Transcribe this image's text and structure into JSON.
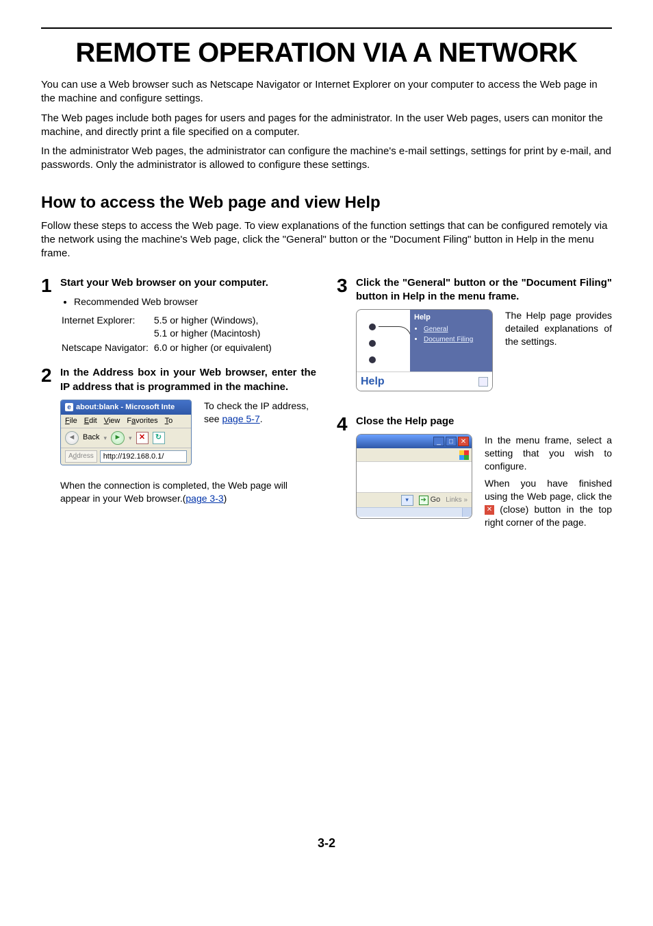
{
  "title": "REMOTE OPERATION VIA A NETWORK",
  "intro": {
    "p1": "You can use a Web browser such as Netscape Navigator or Internet Explorer on your computer to access the Web page in the machine and configure settings.",
    "p2": "The Web pages include both pages for users and pages for the administrator. In the user Web pages, users can monitor the machine, and directly print a file specified on a computer.",
    "p3": "In the administrator Web pages, the administrator can configure the machine's e-mail settings, settings for print by e-mail, and passwords. Only the administrator is allowed to configure these settings."
  },
  "section": {
    "heading": "How to access the Web page and view Help",
    "intro": "Follow these steps to access the Web page. To view explanations of the function settings that can be configured remotely via the network using the machine's Web page, click the \"General\" button or the \"Document Filing\" button in Help in the menu frame."
  },
  "steps": {
    "s1": {
      "num": "1",
      "head": "Start your Web browser on your computer.",
      "bullet": "Recommended Web browser",
      "ie_label": "Internet Explorer:",
      "ie_val1": "5.5 or higher (Windows),",
      "ie_val2": "5.1 or higher (Macintosh)",
      "nn_label": "Netscape Navigator:",
      "nn_val": "6.0 or higher (or equivalent)"
    },
    "s2": {
      "num": "2",
      "head": "In the Address box in your Web browser, enter the IP address that is programmed in the machine.",
      "ie_title": "about:blank - Microsoft Inte",
      "menu": {
        "file": "File",
        "edit": "Edit",
        "view": "View",
        "fav": "Favorites",
        "tools": "To"
      },
      "back": "Back",
      "addr_label": "Address",
      "addr_value": "http://192.168.0.1/",
      "side_t1": "To check the IP address, see ",
      "side_link": "page 5-7",
      "side_t2": ".",
      "after1": "When the connection is completed, the Web page will appear in your Web browser.(",
      "after_link": "page 3-3",
      "after2": ")"
    },
    "s3": {
      "num": "3",
      "head": "Click the \"General\" button or the \"Document Filing\" button in Help in the menu frame.",
      "panel_title": "Help",
      "link_general": "General",
      "link_docfiling": "Document Filing",
      "bottom_word": "Help",
      "side": "The Help page provides detailed explanations of the settings."
    },
    "s4": {
      "num": "4",
      "head": "Close the Help page",
      "go": "Go",
      "links": "Links",
      "side1": "In the menu frame, select a setting that you wish to configure.",
      "side2a": "When you have finished using the Web page, click the ",
      "side2b": " (close) button in the top right corner of the page."
    }
  },
  "page_number": "3-2"
}
